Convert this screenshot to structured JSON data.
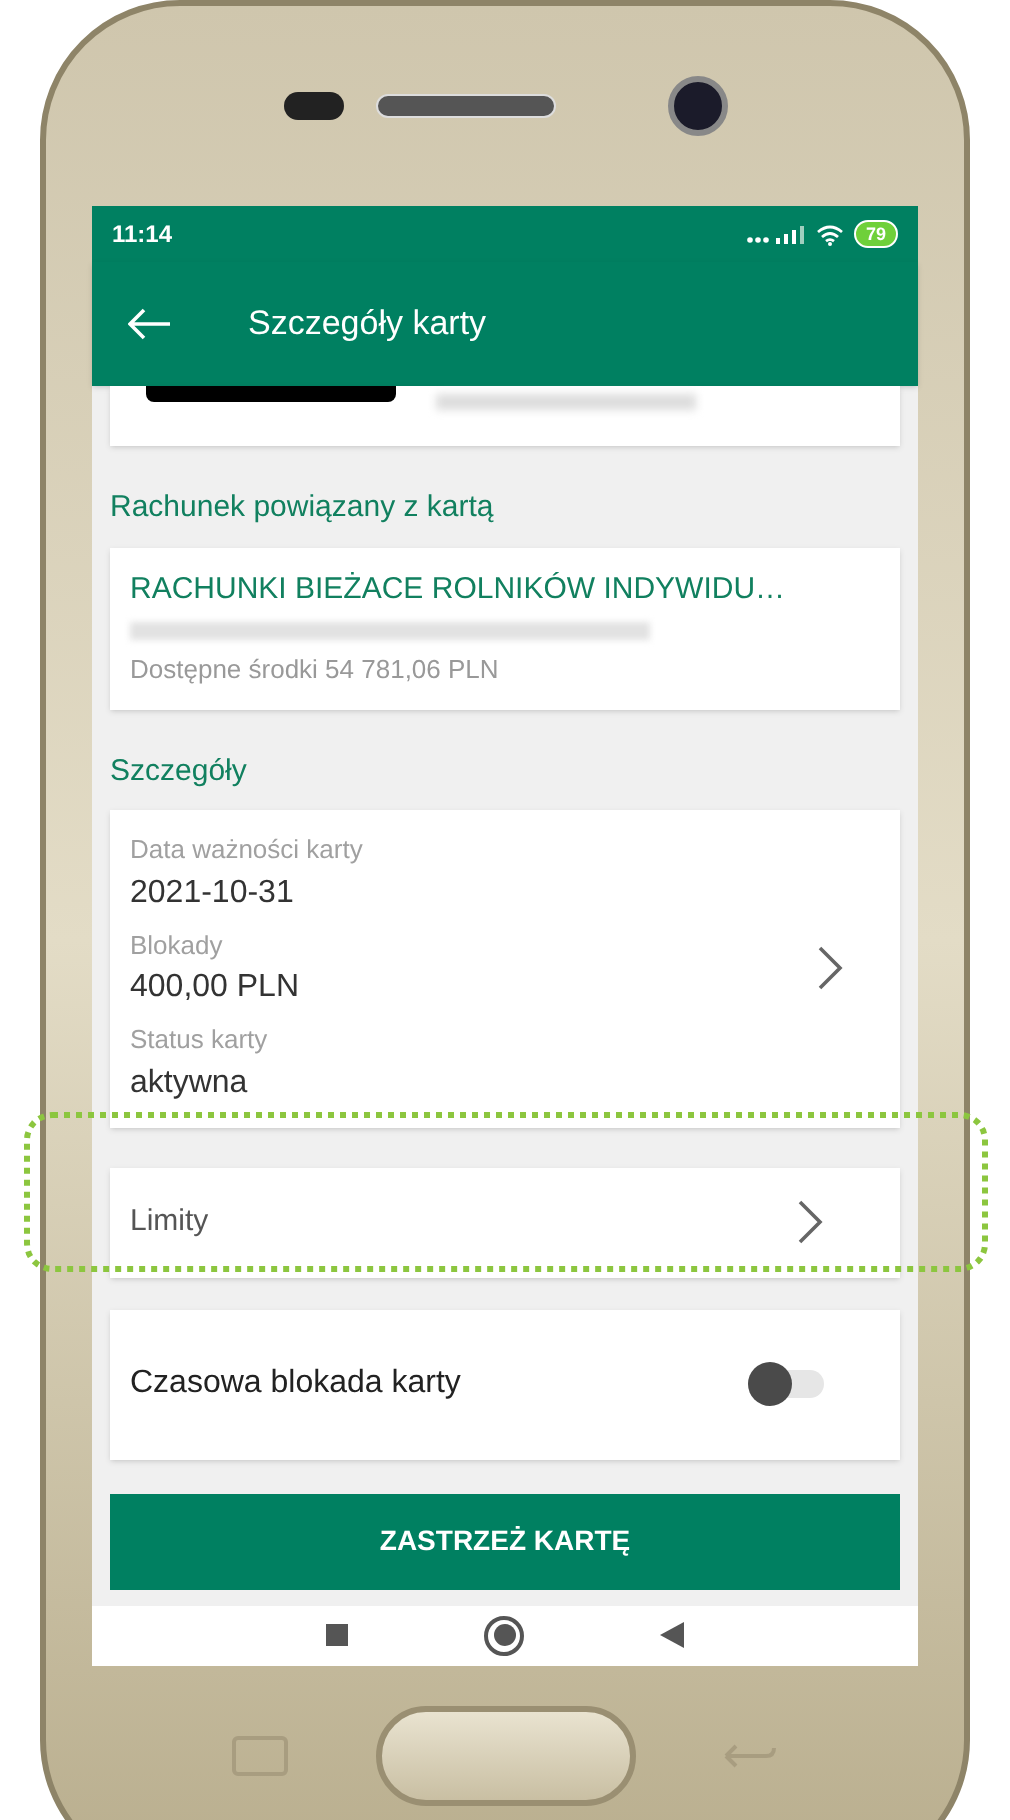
{
  "status_bar": {
    "time": "11:14",
    "battery": "79"
  },
  "app_bar": {
    "title": "Szczegóły karty"
  },
  "linked_account": {
    "heading": "Rachunek powiązany z kartą",
    "name": "RACHUNKI BIEŻACE ROLNIKÓW INDYWIDU…",
    "balance": "Dostępne środki 54 781,06 PLN"
  },
  "details": {
    "heading": "Szczegóły",
    "fields": [
      {
        "label": "Data ważności karty",
        "value": "2021-10-31"
      },
      {
        "label": "Blokady",
        "value": "400,00 PLN"
      },
      {
        "label": "Status karty",
        "value": "aktywna"
      }
    ]
  },
  "limits": {
    "label": "Limity",
    "highlighted": true
  },
  "time_lock": {
    "label": "Czasowa blokada karty",
    "on": false
  },
  "block_button": {
    "label": "ZASTRZEŻ KARTĘ"
  }
}
